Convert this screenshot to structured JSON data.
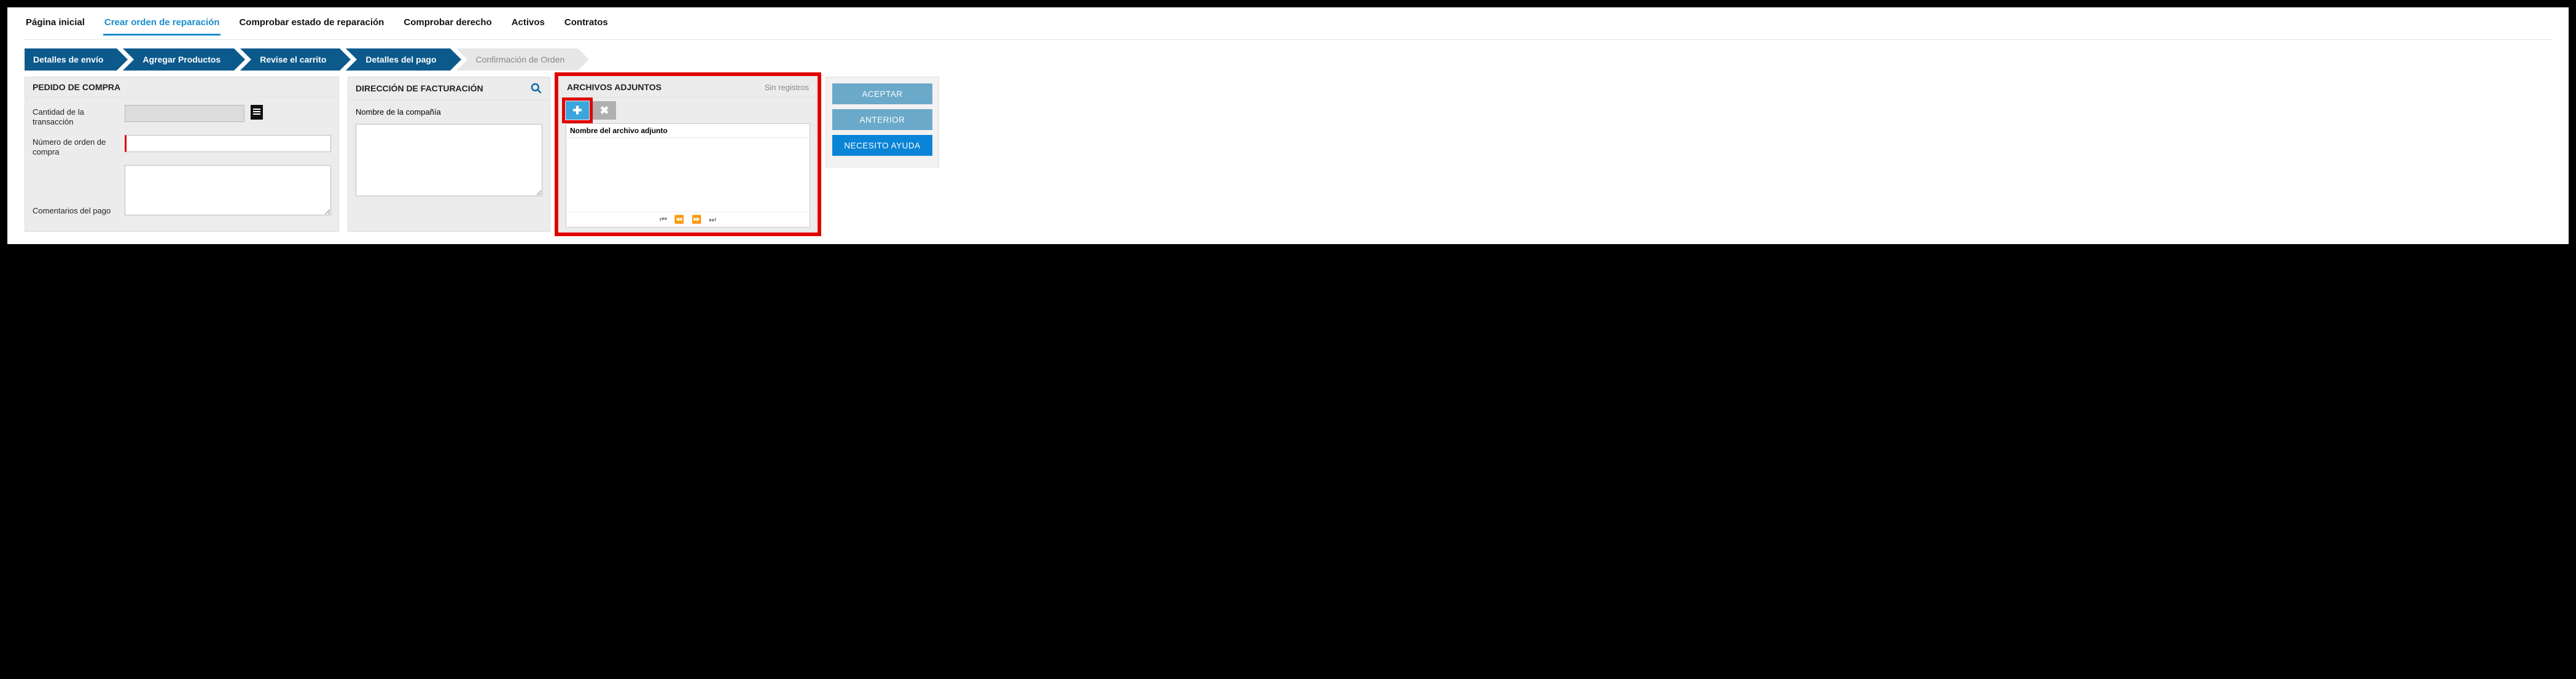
{
  "topnav": {
    "tabs": [
      {
        "label": "Página inicial",
        "active": false
      },
      {
        "label": "Crear orden de reparación",
        "active": true
      },
      {
        "label": "Comprobar estado de reparación",
        "active": false
      },
      {
        "label": "Comprobar derecho",
        "active": false
      },
      {
        "label": "Activos",
        "active": false
      },
      {
        "label": "Contratos",
        "active": false
      }
    ]
  },
  "wizard": {
    "steps": [
      {
        "label": "Detalles de envío",
        "done": true
      },
      {
        "label": "Agregar Productos",
        "done": true
      },
      {
        "label": "Revise el carrito",
        "done": true
      },
      {
        "label": "Detalles del pago",
        "done": true
      },
      {
        "label": "Confirmación de Orden",
        "done": false
      }
    ]
  },
  "pedido": {
    "title": "PEDIDO DE COMPRA",
    "cantidad_label": "Cantidad de la transacción",
    "cantidad_value": "",
    "numero_label": "Número de orden de compra",
    "numero_value": "",
    "comentarios_label": "Comentarios del pago",
    "comentarios_value": ""
  },
  "direccion": {
    "title": "DIRECCIÓN DE FACTURACIÓN",
    "compania_label": "Nombre de la compañía",
    "compania_value": ""
  },
  "adjuntos": {
    "title": "ARCHIVOS ADJUNTOS",
    "no_records": "Sin registros",
    "column_header": "Nombre del archivo adjunto"
  },
  "actions": {
    "accept": "ACEPTAR",
    "previous": "ANTERIOR",
    "help": "NECESITO AYUDA"
  }
}
